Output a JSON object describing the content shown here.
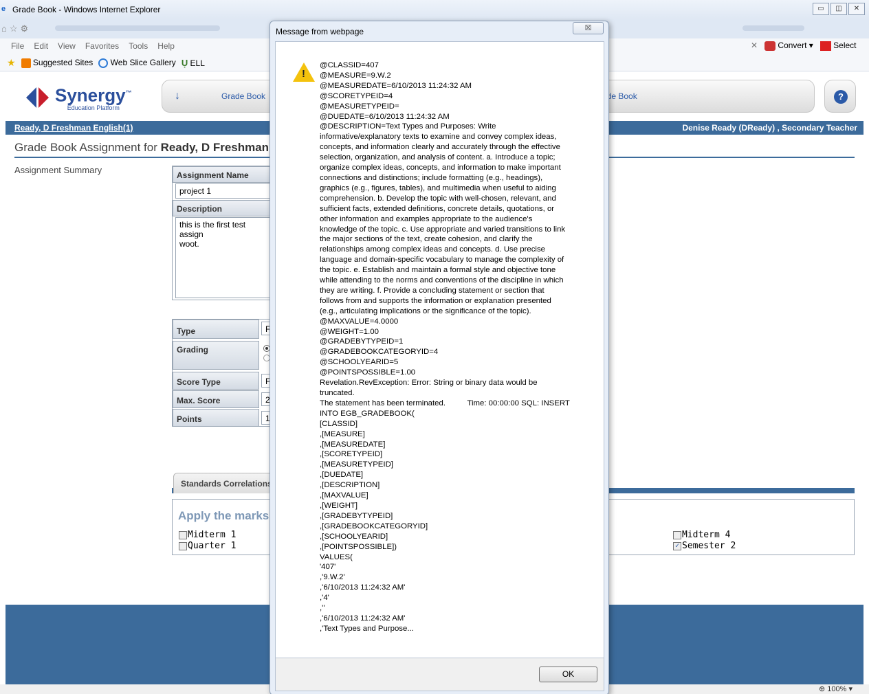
{
  "window": {
    "title": "Grade Book - Windows Internet Explorer"
  },
  "menubar": {
    "items": [
      "File",
      "Edit",
      "View",
      "Favorites",
      "Tools",
      "Help"
    ],
    "convert_label": "Convert",
    "select_label": "Select"
  },
  "favorites": {
    "suggested": "Suggested Sites",
    "slice": "Web Slice Gallery",
    "ell": "ELL"
  },
  "app": {
    "logo_name": "Synergy",
    "logo_tm": "™",
    "logo_sub": "Education Platform",
    "nav_left": "Grade Book",
    "nav_right": "ade Book",
    "help_symbol": "?",
    "class_link": "Ready, D Freshman English(1)",
    "user": "Denise Ready (DReady) , Secondary Teacher",
    "page_title_prefix": "Grade Book Assignment for ",
    "page_title_bold": "Ready, D Freshman",
    "assignment_summary": "Assignment Summary"
  },
  "form": {
    "assignment_name_label": "Assignment Name",
    "assignment_name_value": "project 1",
    "description_label": "Description",
    "description_value": "this is the first test assign\nwoot.",
    "type_label": "Type",
    "type_value": "F",
    "grading_label": "Grading",
    "score_type_label": "Score Type",
    "score_type_value": "F",
    "max_score_label": "Max. Score",
    "max_score_value": "2",
    "points_label": "Points",
    "points_value": "1"
  },
  "standards": {
    "tab_label": "Standards Correlations",
    "apply_label": "Apply the marks",
    "marks": [
      {
        "label": "Midterm 1",
        "checked": false
      },
      {
        "label": "Quarter 1",
        "checked": false
      },
      {
        "label": "Midterm 4",
        "checked": false
      },
      {
        "label": "Semester 2",
        "checked": true
      }
    ]
  },
  "status": {
    "zoom": "100%"
  },
  "dialog": {
    "title": "Message from webpage",
    "close_symbol": "☒",
    "ok_label": "OK",
    "message": "@CLASSID=407\n@MEASURE=9.W.2\n@MEASUREDATE=6/10/2013 11:24:32 AM\n@SCORETYPEID=4\n@MEASURETYPEID=\n@DUEDATE=6/10/2013 11:24:32 AM\n@DESCRIPTION=Text Types and Purposes: Write\ninformative/explanatory texts to examine and convey complex ideas,\nconcepts, and information clearly and accurately through the effective\nselection, organization, and analysis of content. a. Introduce a topic;\norganize complex ideas, concepts, and information to make important\nconnections and distinctions; include formatting (e.g., headings),\ngraphics (e.g., figures, tables), and multimedia when useful to aiding\ncomprehension. b. Develop the topic with well-chosen, relevant, and\nsufficient facts, extended definitions, concrete details, quotations, or\nother information and examples appropriate to the audience's\nknowledge of the topic. c. Use appropriate and varied transitions to link\nthe major sections of the text, create cohesion, and clarify the\nrelationships among complex ideas and concepts. d. Use precise\nlanguage and domain-specific vocabulary to manage the complexity of\nthe topic. e. Establish and maintain a formal style and objective tone\nwhile attending to the norms and conventions of the discipline in which\nthey are writing. f. Provide a concluding statement or section that\nfollows from and supports the information or explanation presented\n(e.g., articulating implications or the significance of the topic).\n@MAXVALUE=4.0000\n@WEIGHT=1.00\n@GRADEBYTYPEID=1\n@GRADEBOOKCATEGORYID=4\n@SCHOOLYEARID=5\n@POINTSPOSSIBLE=1.00\nRevelation.RevException: Error: String or binary data would be\ntruncated.\nThe statement has been terminated.          Time: 00:00:00 SQL: INSERT\nINTO EGB_GRADEBOOK(\n[CLASSID]\n,[MEASURE]\n,[MEASUREDATE]\n,[SCORETYPEID]\n,[MEASURETYPEID]\n,[DUEDATE]\n,[DESCRIPTION]\n,[MAXVALUE]\n,[WEIGHT]\n,[GRADEBYTYPEID]\n,[GRADEBOOKCATEGORYID]\n,[SCHOOLYEARID]\n,[POINTSPOSSIBLE])\nVALUES(\n'407'\n,'9.W.2'\n,'6/10/2013 11:24:32 AM'\n,'4'\n,''\n,'6/10/2013 11:24:32 AM'\n,'Text Types and Purpose..."
  }
}
